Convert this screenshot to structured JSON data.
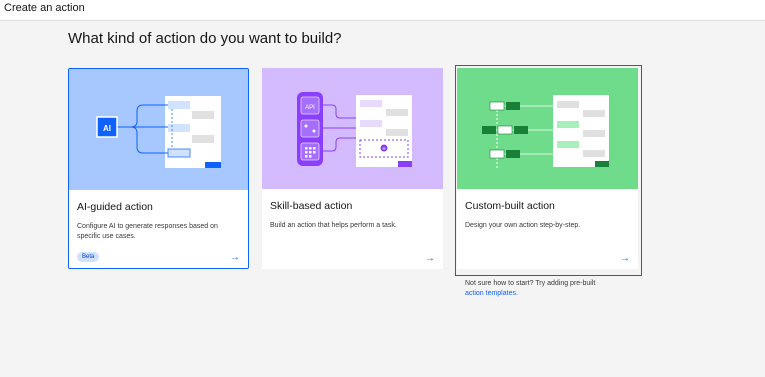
{
  "window": {
    "title": "Create an action"
  },
  "main": {
    "heading": "What kind of action do you want to build?",
    "cards": [
      {
        "title": "AI-guided action",
        "description": "Configure AI to generate responses based on specific use cases.",
        "badge": "Beta",
        "arrow": "→",
        "illustration_label": "AI",
        "accent": "#a6c8ff"
      },
      {
        "title": "Skill-based action",
        "description": "Build an action that helps perform a task.",
        "arrow": "→",
        "illustration_label": "API",
        "accent": "#d4bbff"
      },
      {
        "title": "Custom-built action",
        "description": "Design your own action step-by-step.",
        "arrow": "→",
        "accent": "#6fdc8c"
      }
    ],
    "help": {
      "text": "Not sure how to start? Try adding pre-built",
      "link": "action templates."
    }
  },
  "colors": {
    "link": "#0f62fe",
    "highlight": "#da1e28"
  }
}
